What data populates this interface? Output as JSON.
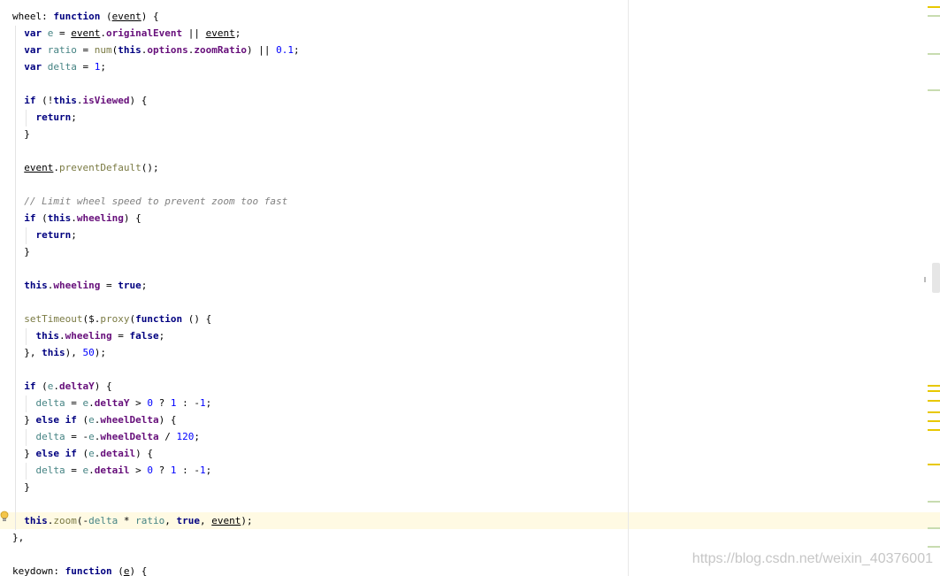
{
  "code_lines": [
    [
      [
        "plain",
        "wheel: "
      ],
      [
        "kw",
        "function"
      ],
      [
        "plain",
        " ("
      ],
      [
        "param",
        "event"
      ],
      [
        "plain",
        ") {"
      ]
    ],
    [
      [
        "plain",
        "  "
      ],
      [
        "kw",
        "var"
      ],
      [
        "plain",
        " "
      ],
      [
        "local",
        "e"
      ],
      [
        "plain",
        " = "
      ],
      [
        "param",
        "event"
      ],
      [
        "plain",
        "."
      ],
      [
        "prop",
        "originalEvent"
      ],
      [
        "plain",
        " || "
      ],
      [
        "param",
        "event"
      ],
      [
        "plain",
        ";"
      ]
    ],
    [
      [
        "plain",
        "  "
      ],
      [
        "kw",
        "var"
      ],
      [
        "plain",
        " "
      ],
      [
        "local",
        "ratio"
      ],
      [
        "plain",
        " = "
      ],
      [
        "fn",
        "num"
      ],
      [
        "plain",
        "("
      ],
      [
        "kw",
        "this"
      ],
      [
        "plain",
        "."
      ],
      [
        "prop",
        "options"
      ],
      [
        "plain",
        "."
      ],
      [
        "prop",
        "zoomRatio"
      ],
      [
        "plain",
        ") || "
      ],
      [
        "num",
        "0.1"
      ],
      [
        "plain",
        ";"
      ]
    ],
    [
      [
        "plain",
        "  "
      ],
      [
        "kw",
        "var"
      ],
      [
        "plain",
        " "
      ],
      [
        "local",
        "delta"
      ],
      [
        "plain",
        " = "
      ],
      [
        "num",
        "1"
      ],
      [
        "plain",
        ";"
      ]
    ],
    [],
    [
      [
        "plain",
        "  "
      ],
      [
        "kw",
        "if"
      ],
      [
        "plain",
        " (!"
      ],
      [
        "kw",
        "this"
      ],
      [
        "plain",
        "."
      ],
      [
        "prop",
        "isViewed"
      ],
      [
        "plain",
        ") {"
      ]
    ],
    [
      [
        "plain",
        "    "
      ],
      [
        "kw",
        "return"
      ],
      [
        "plain",
        ";"
      ]
    ],
    [
      [
        "plain",
        "  }"
      ]
    ],
    [],
    [
      [
        "plain",
        "  "
      ],
      [
        "param",
        "event"
      ],
      [
        "plain",
        "."
      ],
      [
        "fn",
        "preventDefault"
      ],
      [
        "plain",
        "();"
      ]
    ],
    [],
    [
      [
        "plain",
        "  "
      ],
      [
        "cmt",
        "// Limit wheel speed to prevent zoom too fast"
      ]
    ],
    [
      [
        "plain",
        "  "
      ],
      [
        "kw",
        "if"
      ],
      [
        "plain",
        " ("
      ],
      [
        "kw",
        "this"
      ],
      [
        "plain",
        "."
      ],
      [
        "prop",
        "wheeling"
      ],
      [
        "plain",
        ") {"
      ]
    ],
    [
      [
        "plain",
        "    "
      ],
      [
        "kw",
        "return"
      ],
      [
        "plain",
        ";"
      ]
    ],
    [
      [
        "plain",
        "  }"
      ]
    ],
    [],
    [
      [
        "plain",
        "  "
      ],
      [
        "kw",
        "this"
      ],
      [
        "plain",
        "."
      ],
      [
        "prop",
        "wheeling"
      ],
      [
        "plain",
        " = "
      ],
      [
        "kw",
        "true"
      ],
      [
        "plain",
        ";"
      ]
    ],
    [],
    [
      [
        "plain",
        "  "
      ],
      [
        "fn",
        "setTimeout"
      ],
      [
        "plain",
        "($."
      ],
      [
        "fn",
        "proxy"
      ],
      [
        "plain",
        "("
      ],
      [
        "kw",
        "function"
      ],
      [
        "plain",
        " () {"
      ]
    ],
    [
      [
        "plain",
        "    "
      ],
      [
        "kw",
        "this"
      ],
      [
        "plain",
        "."
      ],
      [
        "prop",
        "wheeling"
      ],
      [
        "plain",
        " = "
      ],
      [
        "kw",
        "false"
      ],
      [
        "plain",
        ";"
      ]
    ],
    [
      [
        "plain",
        "  }, "
      ],
      [
        "kw",
        "this"
      ],
      [
        "plain",
        "), "
      ],
      [
        "num",
        "50"
      ],
      [
        "plain",
        ");"
      ]
    ],
    [],
    [
      [
        "plain",
        "  "
      ],
      [
        "kw",
        "if"
      ],
      [
        "plain",
        " ("
      ],
      [
        "local",
        "e"
      ],
      [
        "plain",
        "."
      ],
      [
        "prop",
        "deltaY"
      ],
      [
        "plain",
        ") {"
      ]
    ],
    [
      [
        "plain",
        "    "
      ],
      [
        "local",
        "delta"
      ],
      [
        "plain",
        " = "
      ],
      [
        "local",
        "e"
      ],
      [
        "plain",
        "."
      ],
      [
        "prop",
        "deltaY"
      ],
      [
        "plain",
        " > "
      ],
      [
        "num",
        "0"
      ],
      [
        "plain",
        " ? "
      ],
      [
        "num",
        "1"
      ],
      [
        "plain",
        " : -"
      ],
      [
        "num",
        "1"
      ],
      [
        "plain",
        ";"
      ]
    ],
    [
      [
        "plain",
        "  } "
      ],
      [
        "kw",
        "else if"
      ],
      [
        "plain",
        " ("
      ],
      [
        "local",
        "e"
      ],
      [
        "plain",
        "."
      ],
      [
        "prop",
        "wheelDelta"
      ],
      [
        "plain",
        ") {"
      ]
    ],
    [
      [
        "plain",
        "    "
      ],
      [
        "local",
        "delta"
      ],
      [
        "plain",
        " = -"
      ],
      [
        "local",
        "e"
      ],
      [
        "plain",
        "."
      ],
      [
        "prop",
        "wheelDelta"
      ],
      [
        "plain",
        " / "
      ],
      [
        "num",
        "120"
      ],
      [
        "plain",
        ";"
      ]
    ],
    [
      [
        "plain",
        "  } "
      ],
      [
        "kw",
        "else if"
      ],
      [
        "plain",
        " ("
      ],
      [
        "local",
        "e"
      ],
      [
        "plain",
        "."
      ],
      [
        "prop",
        "detail"
      ],
      [
        "plain",
        ") {"
      ]
    ],
    [
      [
        "plain",
        "    "
      ],
      [
        "local",
        "delta"
      ],
      [
        "plain",
        " = "
      ],
      [
        "local",
        "e"
      ],
      [
        "plain",
        "."
      ],
      [
        "prop",
        "detail"
      ],
      [
        "plain",
        " > "
      ],
      [
        "num",
        "0"
      ],
      [
        "plain",
        " ? "
      ],
      [
        "num",
        "1"
      ],
      [
        "plain",
        " : -"
      ],
      [
        "num",
        "1"
      ],
      [
        "plain",
        ";"
      ]
    ],
    [
      [
        "plain",
        "  }"
      ]
    ],
    [],
    [
      [
        "plain",
        "  "
      ],
      [
        "kw",
        "this"
      ],
      [
        "plain",
        "."
      ],
      [
        "fn",
        "zoom"
      ],
      [
        "plain",
        "(-"
      ],
      [
        "local",
        "delta"
      ],
      [
        "plain",
        " * "
      ],
      [
        "local",
        "ratio"
      ],
      [
        "plain",
        ", "
      ],
      [
        "kw",
        "true"
      ],
      [
        "plain",
        ", "
      ],
      [
        "param",
        "event"
      ],
      [
        "plain",
        ");"
      ]
    ],
    [
      [
        "plain",
        "},"
      ]
    ],
    [],
    [
      [
        "plain",
        "keydown: "
      ],
      [
        "kw",
        "function"
      ],
      [
        "plain",
        " ("
      ],
      [
        "param",
        "e"
      ],
      [
        "plain",
        ") {"
      ]
    ]
  ],
  "highlighted_line_index": 30,
  "watermark": "https://blog.csdn.net/weixin_40376001",
  "colors": {
    "marker_yellow": "#e8c800",
    "marker_green": "#c8dcb0",
    "highlight_line": "#fffae3"
  },
  "icons": [
    "bulb-icon"
  ]
}
